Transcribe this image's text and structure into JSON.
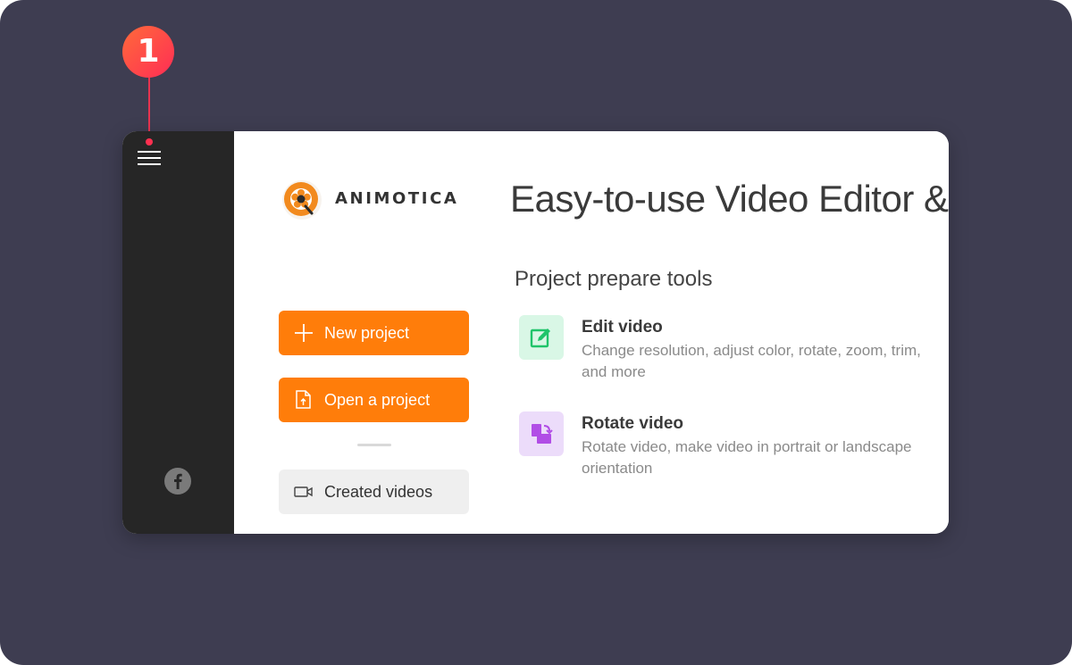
{
  "callout": {
    "number": "1"
  },
  "app": {
    "brand": "ANIMOTICA",
    "headline": "Easy-to-use Video Editor &"
  },
  "actions": {
    "new_project": "New project",
    "open_project": "Open a project",
    "created_videos": "Created videos"
  },
  "tools": {
    "section_title": "Project prepare tools",
    "items": [
      {
        "title": "Edit video",
        "description": "Change resolution, adjust color, rotate, zoom, trim, and more",
        "icon": "edit-icon",
        "color": "#1fc46a",
        "bg": "#d9f7e6"
      },
      {
        "title": "Rotate video",
        "description": "Rotate video, make video in portrait or landscape orientation",
        "icon": "rotate-icon",
        "color": "#b14de6",
        "bg": "#ecdcfa"
      }
    ]
  },
  "sidebar": {
    "social_icon": "facebook-icon"
  },
  "colors": {
    "accent": "#ff7d0a",
    "sidebar": "#262626",
    "backdrop": "#3e3d51",
    "callout": "#ff2d55"
  }
}
